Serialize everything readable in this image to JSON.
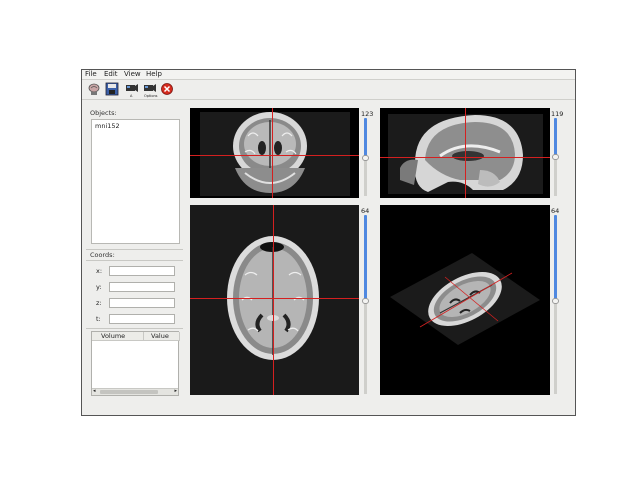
{
  "menu": [
    "File",
    "Edit",
    "View",
    "Help"
  ],
  "toolbar": {
    "icons": [
      "open-brain-icon",
      "save-icon",
      "camera-axial-icon",
      "camera-options-icon",
      "close-stop-icon"
    ],
    "small_labels": [
      "A",
      "Options"
    ]
  },
  "objects": {
    "label": "Objects:",
    "items": [
      "mni152"
    ]
  },
  "coords": {
    "label": "Coords:",
    "fields": [
      {
        "axis": "x:",
        "value": ""
      },
      {
        "axis": "y:",
        "value": ""
      },
      {
        "axis": "z:",
        "value": ""
      },
      {
        "axis": "t:",
        "value": ""
      }
    ]
  },
  "table": {
    "columns": [
      "Volume",
      "Value"
    ]
  },
  "views": {
    "coronal": {
      "slice": "123"
    },
    "sagittal": {
      "slice": "119"
    },
    "axial": {
      "slice": "64"
    },
    "oblique": {
      "slice": "64"
    }
  },
  "colors": {
    "crosshair": "#d42020",
    "slider": "#4f88e0"
  }
}
